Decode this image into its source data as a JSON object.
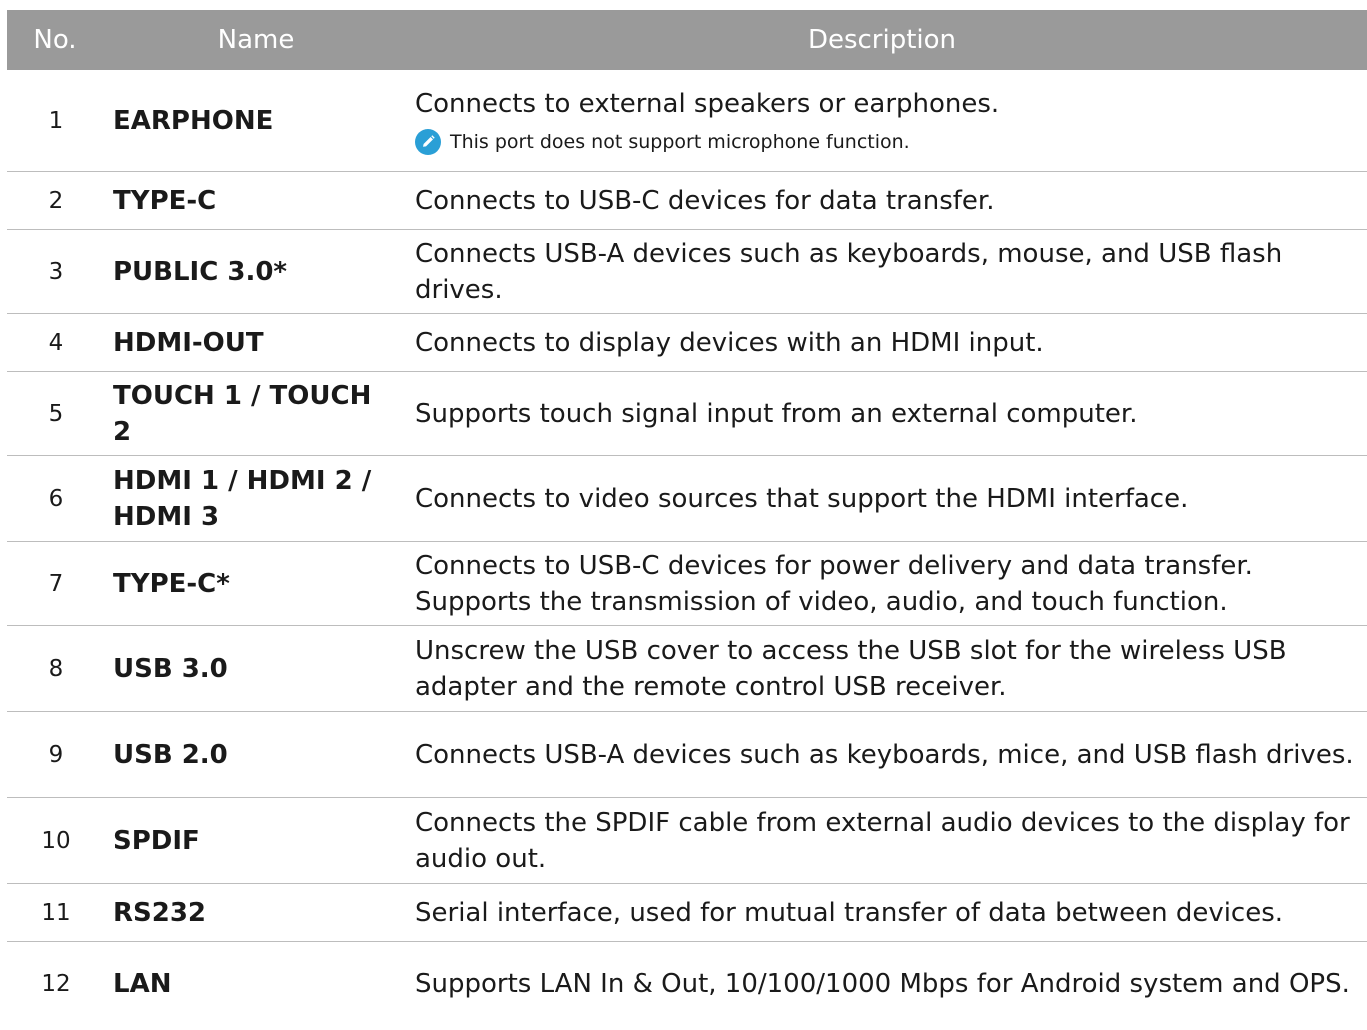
{
  "table": {
    "header": {
      "no": "No.",
      "name": "Name",
      "description": "Description"
    },
    "rows": [
      {
        "no": "1",
        "name": "EARPHONE",
        "description": "Connects to external speakers or earphones.",
        "note": "This port does not support microphone function."
      },
      {
        "no": "2",
        "name": "TYPE-C",
        "description": "Connects to USB-C devices for data transfer."
      },
      {
        "no": "3",
        "name": "PUBLIC 3.0*",
        "description": "Connects USB-A devices such as keyboards, mouse, and USB flash drives."
      },
      {
        "no": "4",
        "name": "HDMI-OUT",
        "description": "Connects to display devices with an HDMI input."
      },
      {
        "no": "5",
        "name": "TOUCH 1 / TOUCH 2",
        "description": "Supports touch signal input from an external computer."
      },
      {
        "no": "6",
        "name": "HDMI 1 / HDMI 2 / HDMI 3",
        "description": "Connects to video sources that support the HDMI interface."
      },
      {
        "no": "7",
        "name": "TYPE-C*",
        "description": "Connects to USB-C devices for power delivery and data transfer. Supports the transmission of video, audio, and touch function."
      },
      {
        "no": "8",
        "name": "USB 3.0",
        "description": "Unscrew the USB cover to access the USB slot for the wireless USB adapter and the remote control USB receiver."
      },
      {
        "no": "9",
        "name": "USB 2.0",
        "description": "Connects USB-A devices such as keyboards, mice, and USB flash drives."
      },
      {
        "no": "10",
        "name": "SPDIF",
        "description": "Connects the SPDIF cable from external audio devices to the display for audio out."
      },
      {
        "no": "11",
        "name": "RS232",
        "description": "Serial interface, used for mutual transfer of data between devices."
      },
      {
        "no": "12",
        "name": "LAN",
        "description": "Supports LAN In & Out, 10/100/1000 Mbps for Android system and OPS."
      }
    ]
  },
  "icons": {
    "note": "pencil-icon"
  },
  "colors": {
    "header_bg": "#9a9a9a",
    "header_text": "#ffffff",
    "note_icon": "#2a9fd6",
    "row_divider": "#bdbdbd"
  }
}
